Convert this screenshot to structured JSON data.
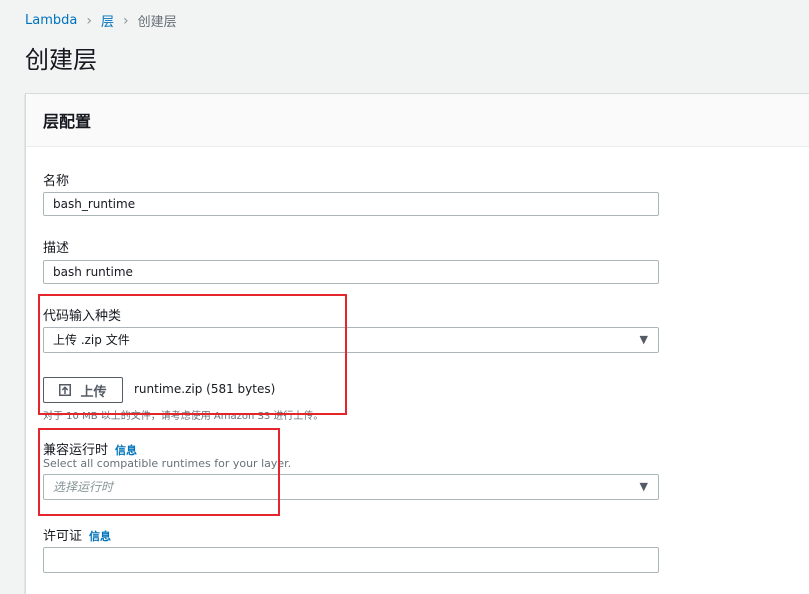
{
  "breadcrumb": {
    "items": [
      "Lambda",
      "层"
    ],
    "current": "创建层"
  },
  "page": {
    "title": "创建层"
  },
  "panel": {
    "title": "层配置",
    "name": {
      "label": "名称",
      "value": "bash_runtime"
    },
    "description": {
      "label": "描述",
      "value": "bash runtime"
    },
    "code_entry": {
      "label": "代码输入种类",
      "selected": "上传 .zip 文件",
      "upload_button": "上传",
      "file_info": "runtime.zip (581 bytes)",
      "hint": "对于 10 MB 以上的文件，请考虑使用 Amazon S3 进行上传。"
    },
    "runtimes": {
      "label": "兼容运行时",
      "info": "信息",
      "description": "Select all compatible runtimes for your layer.",
      "placeholder": "选择运行时"
    },
    "license": {
      "label": "许可证",
      "info": "信息",
      "value": ""
    }
  },
  "colors": {
    "link": "#0073bb",
    "highlight": "#e4252c"
  }
}
